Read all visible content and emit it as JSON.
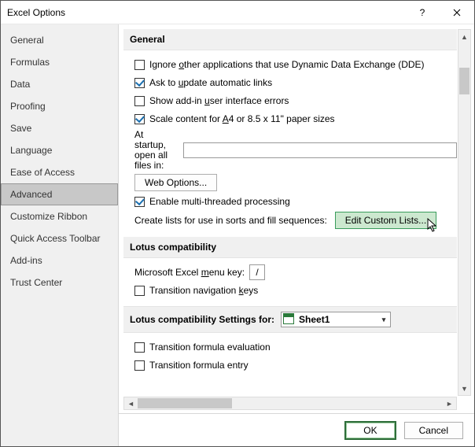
{
  "title": "Excel Options",
  "sidebar": {
    "items": [
      {
        "label": "General"
      },
      {
        "label": "Formulas"
      },
      {
        "label": "Data"
      },
      {
        "label": "Proofing"
      },
      {
        "label": "Save"
      },
      {
        "label": "Language"
      },
      {
        "label": "Ease of Access"
      },
      {
        "label": "Advanced"
      },
      {
        "label": "Customize Ribbon"
      },
      {
        "label": "Quick Access Toolbar"
      },
      {
        "label": "Add-ins"
      },
      {
        "label": "Trust Center"
      }
    ],
    "selected_index": 7
  },
  "sections": {
    "general": {
      "title": "General",
      "ignore_dde": {
        "label_pre": "Ignore ",
        "u": "o",
        "label_post": "ther applications that use Dynamic Data Exchange (DDE)",
        "checked": false
      },
      "ask_update": {
        "label_pre": "Ask to ",
        "u": "u",
        "label_post": "pdate automatic links",
        "checked": true
      },
      "show_addin_err": {
        "label_pre": "Show add-in ",
        "u": "u",
        "label_post": "ser interface errors",
        "checked": false
      },
      "scale_a4": {
        "label_pre": "Scale content for ",
        "u": "A",
        "label_post": "4 or 8.5 x 11\" paper sizes",
        "checked": true
      },
      "startup_label": "At startup, open all files in:",
      "startup_value": "",
      "web_options": "Web Options...",
      "enable_mt": {
        "label": "Enable multi-threaded processing",
        "checked": true
      },
      "create_lists_label": "Create lists for use in sorts and fill sequences:",
      "edit_custom_lists": "Edit Custom Lists..."
    },
    "lotus": {
      "title": "Lotus compatibility",
      "menu_key_label_pre": "Microsoft Excel ",
      "menu_key_u": "m",
      "menu_key_label_post": "enu key:",
      "menu_key_value": "/",
      "transition_nav": {
        "label_pre": "Transition navigation ",
        "u": "k",
        "label_post": "eys",
        "checked": false
      }
    },
    "lotus_for": {
      "title": "Lotus compatibility Settings for:",
      "sheet": "Sheet1",
      "formula_eval": {
        "label": "Transition formula evaluation",
        "checked": false
      },
      "formula_entry": {
        "label": "Transition formula entry",
        "checked": false
      }
    }
  },
  "footer": {
    "ok": "OK",
    "cancel": "Cancel"
  }
}
